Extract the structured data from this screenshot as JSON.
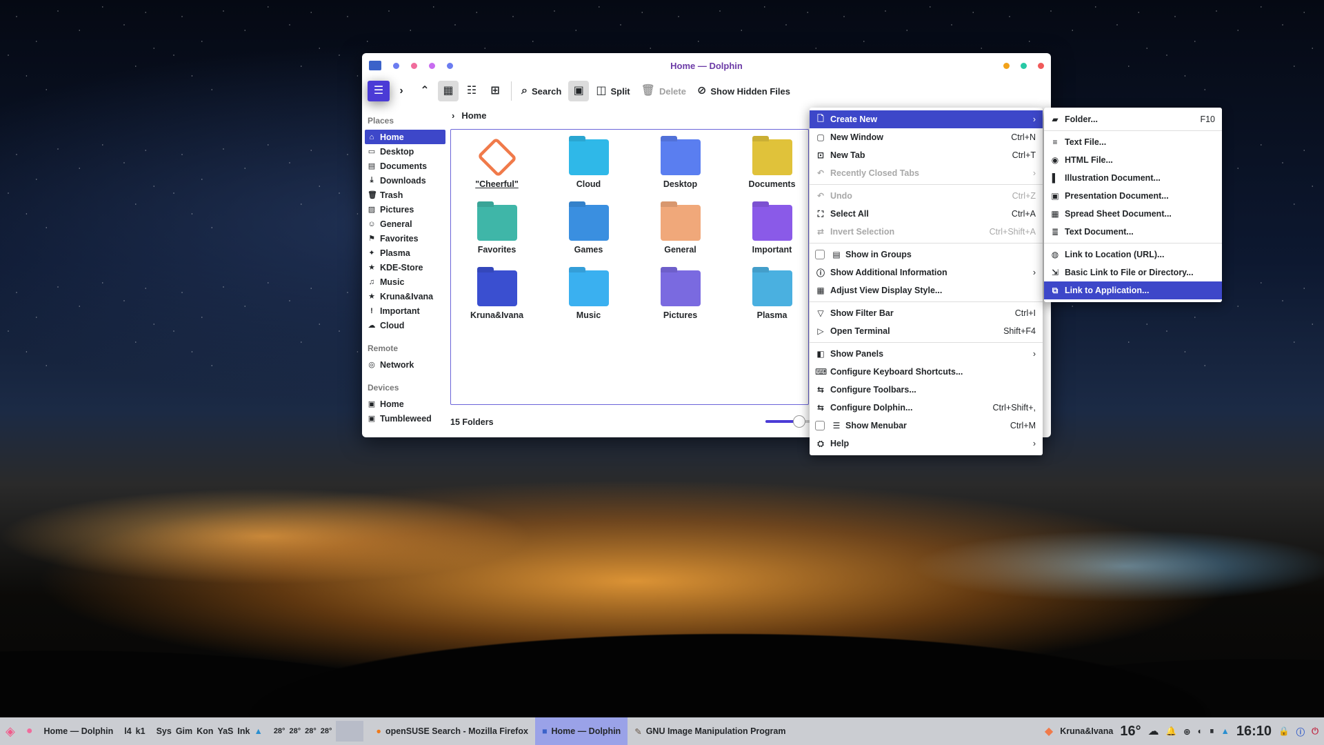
{
  "window": {
    "title": "Home — Dolphin",
    "traffic_left": [
      "#6b7cf0",
      "#f06c9c",
      "#c86cf0",
      "#6b7cf0"
    ],
    "traffic_right": [
      "#f2a21a",
      "#27c9a5",
      "#f05a5a"
    ]
  },
  "toolbar": {
    "search_label": "Search",
    "split_label": "Split",
    "delete_label": "Delete",
    "hidden_label": "Show Hidden Files"
  },
  "sidebar": {
    "places_header": "Places",
    "places": [
      {
        "label": "Home",
        "icon": "home-icon"
      },
      {
        "label": "Desktop",
        "icon": "desktop-icon"
      },
      {
        "label": "Documents",
        "icon": "documents-icon"
      },
      {
        "label": "Downloads",
        "icon": "download-icon"
      },
      {
        "label": "Trash",
        "icon": "trash-icon"
      },
      {
        "label": "Pictures",
        "icon": "pictures-icon"
      },
      {
        "label": "General",
        "icon": "user-group-icon"
      },
      {
        "label": "Favorites",
        "icon": "favorites-icon"
      },
      {
        "label": "Plasma",
        "icon": "plasma-icon"
      },
      {
        "label": "KDE-Store",
        "icon": "star-icon"
      },
      {
        "label": "Music",
        "icon": "music-icon"
      },
      {
        "label": "Kruna&Ivana",
        "icon": "star-icon"
      },
      {
        "label": "Important",
        "icon": "exclamation-icon"
      },
      {
        "label": "Cloud",
        "icon": "cloud-icon"
      }
    ],
    "remote_header": "Remote",
    "remote": [
      {
        "label": "Network",
        "icon": "network-icon"
      }
    ],
    "devices_header": "Devices",
    "devices": [
      {
        "label": "Home",
        "icon": "drive-icon"
      },
      {
        "label": "Tumbleweed",
        "icon": "drive-icon"
      }
    ]
  },
  "breadcrumb": {
    "current": "Home"
  },
  "folders": [
    {
      "label": "\"Cheerful\"",
      "color": "#f07a4a"
    },
    {
      "label": "Cloud",
      "color": "#2fb8e8"
    },
    {
      "label": "Desktop",
      "color": "#5a7ef0"
    },
    {
      "label": "Documents",
      "color": "#e0c23a"
    },
    {
      "label": "Favorites",
      "color": "#3fb6a8"
    },
    {
      "label": "Games",
      "color": "#3a8fe0"
    },
    {
      "label": "General",
      "color": "#f0a87a"
    },
    {
      "label": "Important",
      "color": "#8a5ae8"
    },
    {
      "label": "Kruna&Ivana",
      "color": "#3a4fd0"
    },
    {
      "label": "Music",
      "color": "#3ab0f0"
    },
    {
      "label": "Pictures",
      "color": "#7a6ae0"
    },
    {
      "label": "Plasma",
      "color": "#4ab0e0"
    }
  ],
  "status": {
    "count": "15 Folders",
    "zoom_fraction": 0.28
  },
  "main_menu": [
    {
      "label": "Create New",
      "icon": "new-file-icon",
      "arrow": true,
      "highlight": true
    },
    {
      "label": "New Window",
      "icon": "new-window-icon",
      "shortcut": "Ctrl+N"
    },
    {
      "label": "New Tab",
      "icon": "new-tab-icon",
      "shortcut": "Ctrl+T"
    },
    {
      "label": "Recently Closed Tabs",
      "icon": "undo-icon",
      "arrow": true,
      "disabled": true
    },
    {
      "sep": true
    },
    {
      "label": "Undo",
      "icon": "undo-icon",
      "shortcut": "Ctrl+Z",
      "disabled": true
    },
    {
      "label": "Select All",
      "icon": "select-all-icon",
      "shortcut": "Ctrl+A"
    },
    {
      "label": "Invert Selection",
      "icon": "invert-icon",
      "shortcut": "Ctrl+Shift+A",
      "disabled": true
    },
    {
      "sep": true
    },
    {
      "label": "Show in Groups",
      "icon": "groups-icon",
      "checkbox": true
    },
    {
      "label": "Show Additional Information",
      "icon": "info-icon",
      "arrow": true
    },
    {
      "label": "Adjust View Display Style...",
      "icon": "view-style-icon"
    },
    {
      "sep": true
    },
    {
      "label": "Show Filter Bar",
      "icon": "filter-icon",
      "shortcut": "Ctrl+I"
    },
    {
      "label": "Open Terminal",
      "icon": "terminal-icon",
      "shortcut": "Shift+F4"
    },
    {
      "sep": true
    },
    {
      "label": "Show Panels",
      "icon": "panels-icon",
      "arrow": true
    },
    {
      "label": "Configure Keyboard Shortcuts...",
      "icon": "keyboard-icon"
    },
    {
      "label": "Configure Toolbars...",
      "icon": "configure-icon"
    },
    {
      "label": "Configure Dolphin...",
      "icon": "configure-icon",
      "shortcut": "Ctrl+Shift+,"
    },
    {
      "label": "Show Menubar",
      "icon": "menubar-icon",
      "shortcut": "Ctrl+M",
      "checkbox": true
    },
    {
      "label": "Help",
      "icon": "help-icon",
      "arrow": true
    }
  ],
  "submenu": [
    {
      "label": "Folder...",
      "icon": "folder-icon",
      "shortcut": "F10"
    },
    {
      "sep": true
    },
    {
      "label": "Text File...",
      "icon": "text-file-icon"
    },
    {
      "label": "HTML File...",
      "icon": "html-file-icon"
    },
    {
      "label": "Illustration Document...",
      "icon": "illustration-icon"
    },
    {
      "label": "Presentation Document...",
      "icon": "presentation-icon"
    },
    {
      "label": "Spread Sheet Document...",
      "icon": "spreadsheet-icon"
    },
    {
      "label": "Text Document...",
      "icon": "text-document-icon"
    },
    {
      "sep": true
    },
    {
      "label": "Link to Location (URL)...",
      "icon": "link-url-icon"
    },
    {
      "label": "Basic Link to File or Directory...",
      "icon": "link-file-icon"
    },
    {
      "label": "Link to Application...",
      "icon": "link-app-icon",
      "highlight": true
    }
  ],
  "taskbar": {
    "task_dolphin": "Home — Dolphin",
    "pager": [
      "l4",
      "k1"
    ],
    "quick": [
      "Sys",
      "Gim",
      "Kon",
      "YaS",
      "Ink"
    ],
    "temps": [
      "28°",
      "28°",
      "28°",
      "28°"
    ],
    "firefox": "openSUSE Search - Mozilla Firefox",
    "dolphin": "Home — Dolphin",
    "gimp": "GNU Image Manipulation Program",
    "user": "Kruna&Ivana",
    "weather": "16°",
    "time": "16:10"
  }
}
